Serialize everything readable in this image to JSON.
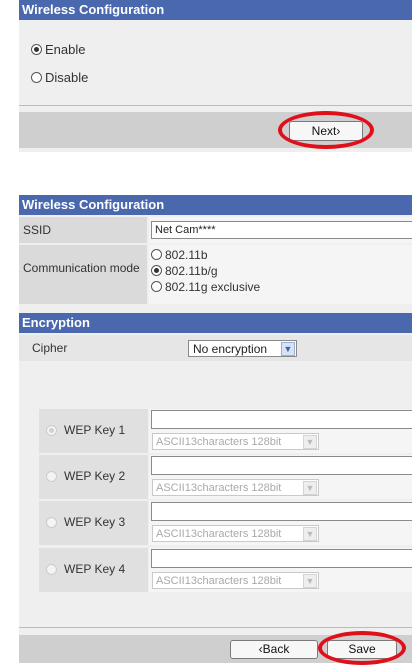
{
  "panel1": {
    "header": "Wireless Configuration",
    "options": [
      {
        "label": "Enable",
        "checked": true
      },
      {
        "label": "Disable",
        "checked": false
      }
    ],
    "next_label": "Next›"
  },
  "panel2": {
    "header": "Wireless Configuration",
    "ssid_label": "SSID",
    "ssid_value": "Net Cam****",
    "comm_label": "Communication mode",
    "comm_options": [
      {
        "label": "802.11b",
        "checked": false
      },
      {
        "label": "802.11b/g",
        "checked": true
      },
      {
        "label": "802.11g exclusive",
        "checked": false
      }
    ],
    "encryption_header": "Encryption",
    "cipher_label": "Cipher",
    "cipher_value": "No encryption",
    "wep_keys": [
      {
        "label": "WEP Key 1",
        "value": "",
        "length": "ASCII13characters 128bit",
        "selected": true
      },
      {
        "label": "WEP Key 2",
        "value": "",
        "length": "ASCII13characters 128bit",
        "selected": false
      },
      {
        "label": "WEP Key 3",
        "value": "",
        "length": "ASCII13characters 128bit",
        "selected": false
      },
      {
        "label": "WEP Key 4",
        "value": "",
        "length": "ASCII13characters 128bit",
        "selected": false
      }
    ],
    "back_label": "‹Back",
    "save_label": "Save"
  },
  "colors": {
    "header_bg": "#4a68ad",
    "highlight_ring": "#e0101a"
  },
  "icons": {
    "dropdown": "chevron-down-icon"
  }
}
